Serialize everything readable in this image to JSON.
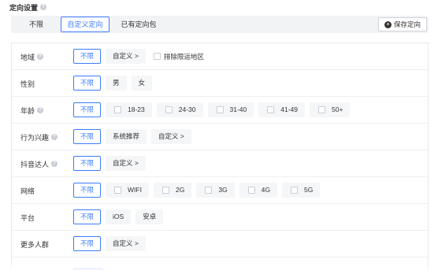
{
  "section": {
    "title": "定向设置"
  },
  "mode": {
    "tabs": [
      {
        "label": "不限"
      },
      {
        "label": "自定义定向"
      },
      {
        "label": "已有定向包"
      }
    ],
    "active_index": 1
  },
  "toolbar": {
    "save_label": "保存定向"
  },
  "rows": [
    {
      "label": "地域",
      "options": [
        "不限",
        "自定义 >"
      ],
      "extra_checkbox": "排除限运地区"
    },
    {
      "label": "性别",
      "options": [
        "不限",
        "男",
        "女"
      ]
    },
    {
      "label": "年龄",
      "options": [
        "不限",
        "18-23",
        "24-30",
        "31-40",
        "41-49",
        "50+"
      ]
    },
    {
      "label": "行为兴趣",
      "options": [
        "不限",
        "系统推荐",
        "自定义 >"
      ]
    },
    {
      "label": "抖音达人",
      "options": [
        "不限",
        "自定义 >"
      ]
    },
    {
      "label": "网络",
      "options": [
        "不限",
        "WIFI",
        "2G",
        "3G",
        "4G",
        "5G"
      ]
    },
    {
      "label": "平台",
      "options": [
        "不限",
        "iOS",
        "安卓"
      ]
    },
    {
      "label": "更多人群",
      "options": [
        "不限",
        "自定义 >"
      ]
    }
  ],
  "colors": {
    "accent": "#3b7cff",
    "border": "#e6e8eb",
    "button_bg": "#f5f6f7"
  }
}
